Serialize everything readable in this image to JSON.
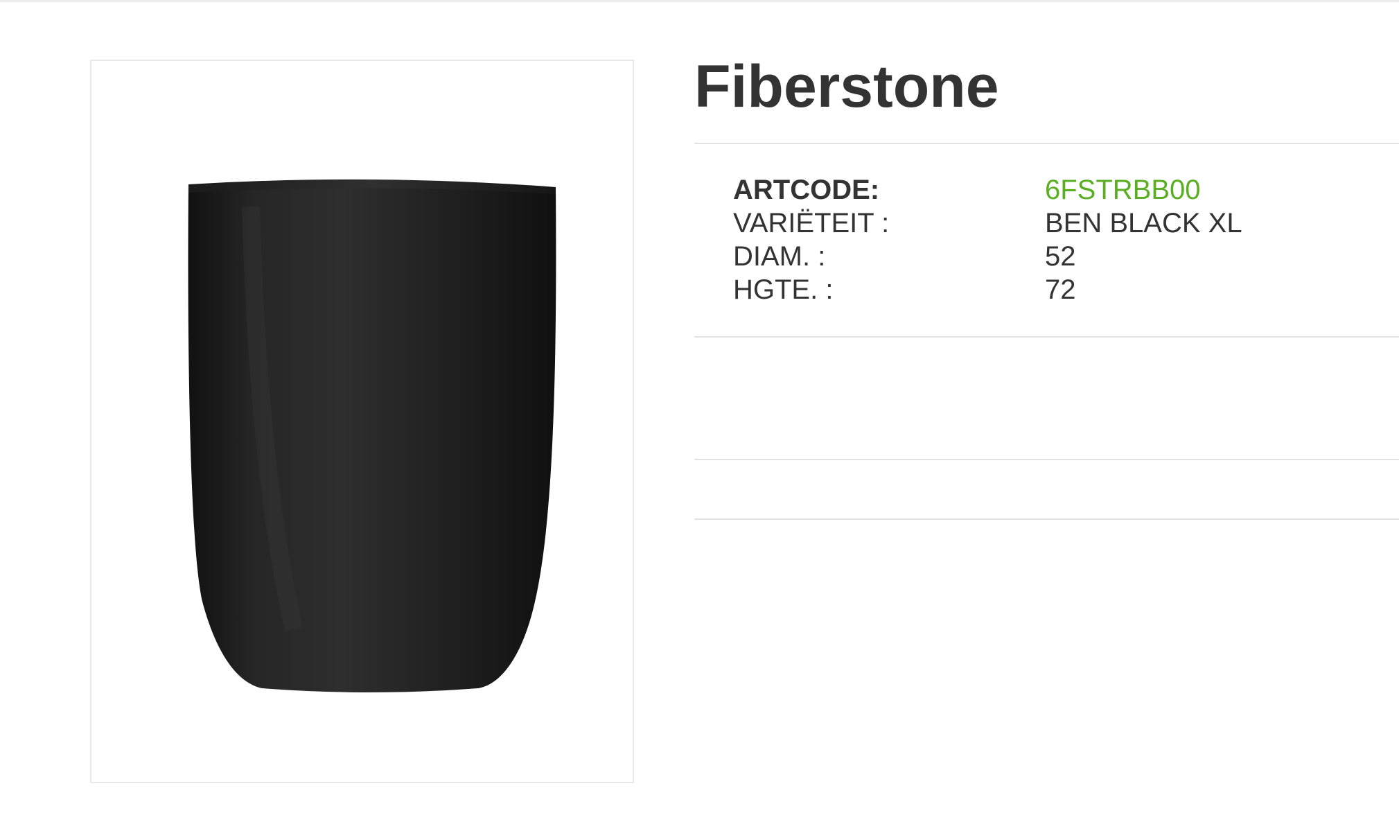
{
  "product": {
    "title": "Fiberstone",
    "image_subject": "black-planter-pot",
    "specs": [
      {
        "label": "ARTCODE:",
        "value": "6FSTRBB00"
      },
      {
        "label": "VARIËTEIT :",
        "value": "BEN BLACK XL"
      },
      {
        "label": "DIAM. :",
        "value": "52"
      },
      {
        "label": "HGTE. :",
        "value": "72"
      }
    ]
  },
  "colors": {
    "title": "#333333",
    "artcode_value": "#5aae22",
    "pot": "#1f1f1f",
    "divider": "#e2e2e2"
  }
}
